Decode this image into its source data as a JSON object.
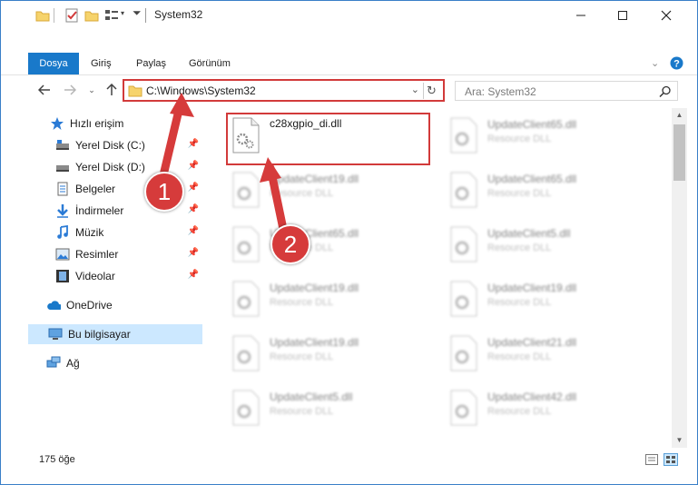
{
  "window": {
    "title": "System32"
  },
  "ribbon": {
    "tabs": [
      "Dosya",
      "Giriş",
      "Paylaş",
      "Görünüm"
    ]
  },
  "address": {
    "path": "C:\\Windows\\System32"
  },
  "search": {
    "placeholder": "Ara: System32"
  },
  "sidebar": {
    "items": [
      {
        "label": "Hızlı erişim",
        "icon": "star-icon",
        "pinned": false
      },
      {
        "label": "Yerel Disk (C:)",
        "icon": "drive-icon",
        "pinned": true
      },
      {
        "label": "Yerel Disk (D:)",
        "icon": "drive-icon",
        "pinned": true
      },
      {
        "label": "Belgeler",
        "icon": "document-icon",
        "pinned": true
      },
      {
        "label": "İndirmeler",
        "icon": "download-icon",
        "pinned": true
      },
      {
        "label": "Müzik",
        "icon": "music-icon",
        "pinned": true
      },
      {
        "label": "Resimler",
        "icon": "picture-icon",
        "pinned": true
      },
      {
        "label": "Videolar",
        "icon": "video-icon",
        "pinned": true
      },
      {
        "label": "OneDrive",
        "icon": "cloud-icon",
        "pinned": false
      },
      {
        "label": "Bu bilgisayar",
        "icon": "computer-icon",
        "pinned": false,
        "selected": true
      },
      {
        "label": "Ağ",
        "icon": "network-icon",
        "pinned": false
      }
    ]
  },
  "files": [
    {
      "name": "c28xgpio_di.dll",
      "type": "",
      "highlighted": true
    },
    {
      "name": "UpdateClient65.dll",
      "type": "Resource DLL"
    },
    {
      "name": "UpdateClient19.dll",
      "type": "Resource DLL"
    },
    {
      "name": "UpdateClient65.dll",
      "type": "Resource DLL"
    },
    {
      "name": "UpdateClient65.dll",
      "type": "Resource DLL"
    },
    {
      "name": "UpdateClient5.dll",
      "type": "Resource DLL"
    },
    {
      "name": "UpdateClient19.dll",
      "type": "Resource DLL"
    },
    {
      "name": "UpdateClient19.dll",
      "type": "Resource DLL"
    },
    {
      "name": "UpdateClient19.dll",
      "type": "Resource DLL"
    },
    {
      "name": "UpdateClient21.dll",
      "type": "Resource DLL"
    },
    {
      "name": "UpdateClient5.dll",
      "type": "Resource DLL"
    },
    {
      "name": "UpdateClient42.dll",
      "type": "Resource DLL"
    }
  ],
  "status": {
    "count": "175 öğe"
  },
  "callouts": [
    "1",
    "2"
  ],
  "colors": {
    "accent": "#1979ca",
    "annotation": "#d63b3b",
    "selection": "#cce8ff"
  }
}
